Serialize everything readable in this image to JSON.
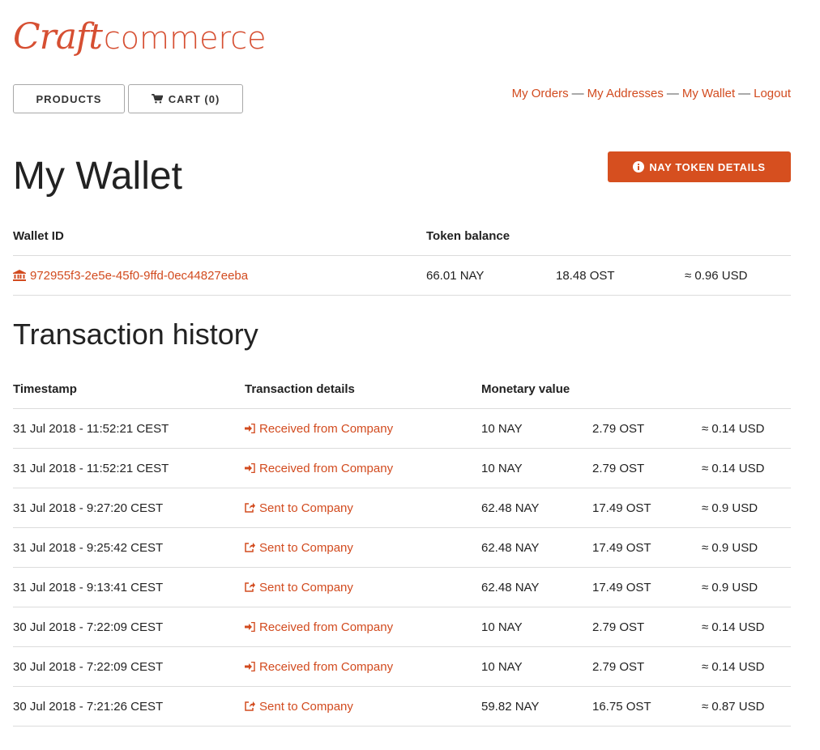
{
  "brand": {
    "craft": "Craft",
    "commerce": "commerce",
    "color": "#d64f32"
  },
  "nav": {
    "products_label": "PRODUCTS",
    "cart_label": "CART (0)",
    "links": [
      "My Orders",
      "My Addresses",
      "My Wallet",
      "Logout"
    ],
    "separator": "—"
  },
  "page": {
    "title": "My Wallet",
    "token_button_label": "NAY TOKEN DETAILS",
    "accent": "#d64f1f"
  },
  "wallet": {
    "headers": {
      "wallet_id": "Wallet ID",
      "token_balance": "Token balance"
    },
    "id": "972955f3-2e5e-45f0-9ffd-0ec44827eeba",
    "nay": "66.01 NAY",
    "ost": "18.48 OST",
    "usd": "≈ 0.96 USD",
    "icon": "bank-icon"
  },
  "transactions": {
    "title": "Transaction history",
    "headers": {
      "timestamp": "Timestamp",
      "details": "Transaction details",
      "value": "Monetary value"
    },
    "rows": [
      {
        "timestamp": "31 Jul 2018 - 11:52:21 CEST",
        "detail": "Received from Company",
        "icon": "sign-in-icon",
        "nay": "10 NAY",
        "ost": "2.79 OST",
        "usd": "≈ 0.14 USD"
      },
      {
        "timestamp": "31 Jul 2018 - 11:52:21 CEST",
        "detail": "Received from Company",
        "icon": "sign-in-icon",
        "nay": "10 NAY",
        "ost": "2.79 OST",
        "usd": "≈ 0.14 USD"
      },
      {
        "timestamp": "31 Jul 2018 - 9:27:20 CEST",
        "detail": "Sent to Company",
        "icon": "share-icon",
        "nay": "62.48 NAY",
        "ost": "17.49 OST",
        "usd": "≈ 0.9 USD"
      },
      {
        "timestamp": "31 Jul 2018 - 9:25:42 CEST",
        "detail": "Sent to Company",
        "icon": "share-icon",
        "nay": "62.48 NAY",
        "ost": "17.49 OST",
        "usd": "≈ 0.9 USD"
      },
      {
        "timestamp": "31 Jul 2018 - 9:13:41 CEST",
        "detail": "Sent to Company",
        "icon": "share-icon",
        "nay": "62.48 NAY",
        "ost": "17.49 OST",
        "usd": "≈ 0.9 USD"
      },
      {
        "timestamp": "30 Jul 2018 - 7:22:09 CEST",
        "detail": "Received from Company",
        "icon": "sign-in-icon",
        "nay": "10 NAY",
        "ost": "2.79 OST",
        "usd": "≈ 0.14 USD"
      },
      {
        "timestamp": "30 Jul 2018 - 7:22:09 CEST",
        "detail": "Received from Company",
        "icon": "sign-in-icon",
        "nay": "10 NAY",
        "ost": "2.79 OST",
        "usd": "≈ 0.14 USD"
      },
      {
        "timestamp": "30 Jul 2018 - 7:21:26 CEST",
        "detail": "Sent to Company",
        "icon": "share-icon",
        "nay": "59.82 NAY",
        "ost": "16.75 OST",
        "usd": "≈ 0.87 USD"
      }
    ]
  }
}
